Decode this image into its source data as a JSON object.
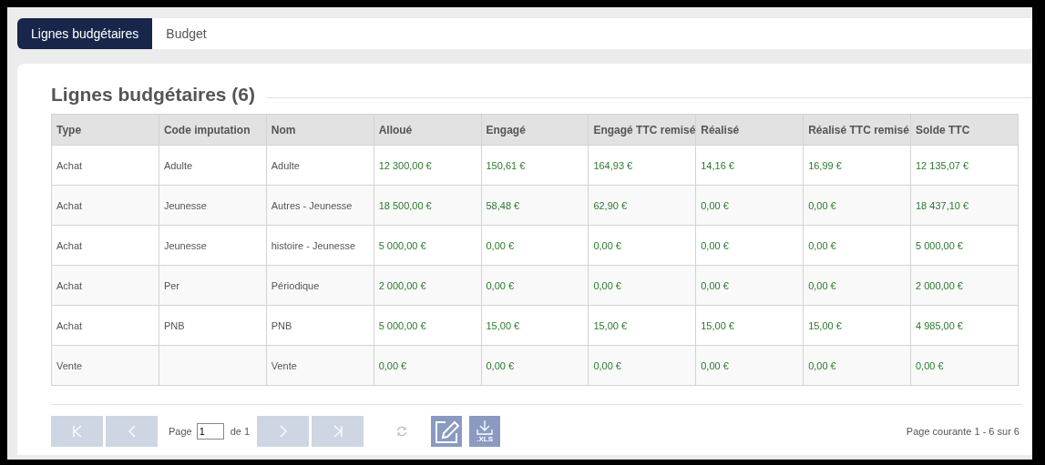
{
  "tabs": [
    {
      "label": "Lignes budgétaires",
      "selected": true
    },
    {
      "label": "Budget",
      "selected": false
    }
  ],
  "section_title": "Lignes budgétaires (6)",
  "table": {
    "columns": [
      "Type",
      "Code imputation",
      "Nom",
      "Alloué",
      "Engagé",
      "Engagé TTC remisé",
      "Réalisé",
      "Réalisé TTC remisé",
      "Solde TTC"
    ],
    "rows": [
      [
        "Achat",
        "Adulte",
        "Adulte",
        "12 300,00 €",
        "150,61 €",
        "164,93 €",
        "14,16 €",
        "16,99 €",
        "12 135,07 €"
      ],
      [
        "Achat",
        "Jeunesse",
        "Autres - Jeunesse",
        "18 500,00 €",
        "58,48 €",
        "62,90 €",
        "0,00 €",
        "0,00 €",
        "18 437,10 €"
      ],
      [
        "Achat",
        "Jeunesse",
        "histoire - Jeunesse",
        "5 000,00 €",
        "0,00 €",
        "0,00 €",
        "0,00 €",
        "0,00 €",
        "5 000,00 €"
      ],
      [
        "Achat",
        "Per",
        "Périodique",
        "2 000,00 €",
        "0,00 €",
        "0,00 €",
        "0,00 €",
        "0,00 €",
        "2 000,00 €"
      ],
      [
        "Achat",
        "PNB",
        "PNB",
        "5 000,00 €",
        "15,00 €",
        "15,00 €",
        "15,00 €",
        "15,00 €",
        "4 985,00 €"
      ],
      [
        "Vente",
        "",
        "Vente",
        "0,00 €",
        "0,00 €",
        "0,00 €",
        "0,00 €",
        "0,00 €",
        "0,00 €"
      ]
    ]
  },
  "pager": {
    "first": {
      "disabled": true
    },
    "previous": {
      "disabled": true
    },
    "page_label": "Page",
    "page_value": "1",
    "of_label": "de 1",
    "next": {
      "disabled": true
    },
    "last": {
      "disabled": true
    },
    "xls_label": ".XLS",
    "summary": "Page courante 1 - 6 sur 6"
  }
}
